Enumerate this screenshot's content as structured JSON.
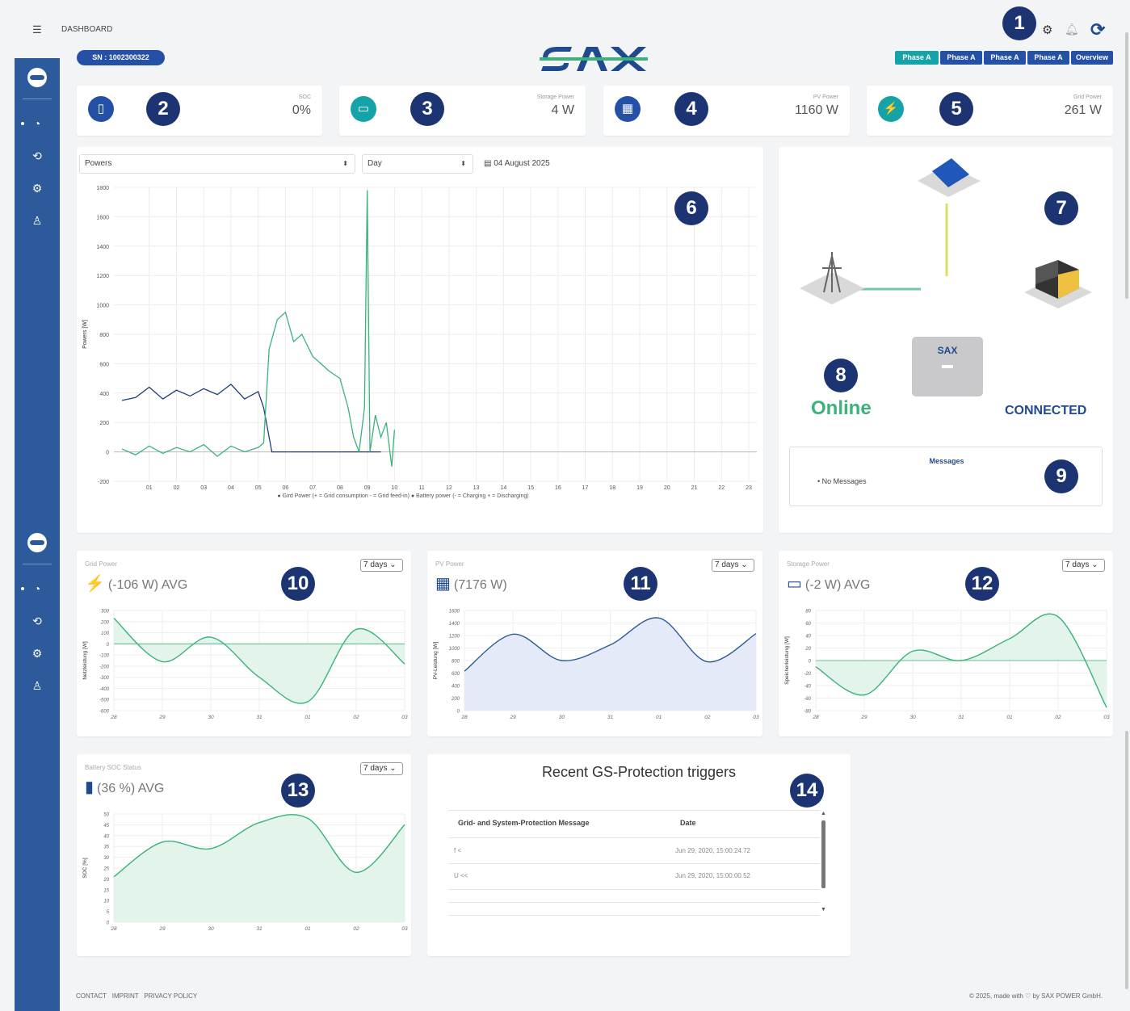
{
  "header": {
    "breadcrumb": "DASHBOARD",
    "serial_badge": "SN : 1002300322",
    "logo_text": "SAX",
    "phase_buttons": [
      "Phase A",
      "Phase A",
      "Phase A",
      "Phase A",
      "Overview"
    ]
  },
  "markers": [
    "1",
    "2",
    "3",
    "4",
    "5",
    "6",
    "7",
    "8",
    "9",
    "10",
    "11",
    "12",
    "13",
    "14"
  ],
  "stats": [
    {
      "label": "SOC",
      "value": "0%",
      "icon": "battery-charge-icon",
      "color": "#2450a6"
    },
    {
      "label": "Storage Power",
      "value": "4 W",
      "icon": "storage-icon",
      "color": "#16a3a8"
    },
    {
      "label": "PV Power",
      "value": "1160 W",
      "icon": "solar-panel-icon",
      "color": "#2450a6"
    },
    {
      "label": "Grid Power",
      "value": "261 W",
      "icon": "grid-tower-icon",
      "color": "#16a3a8"
    }
  ],
  "main_chart": {
    "select_metric": "Powers",
    "select_period": "Day",
    "date": "04 August 2025",
    "chart_data": {
      "type": "line",
      "ylabel": "Powers [W]",
      "ylim": [
        -200,
        1800
      ],
      "yticks": [
        "1800",
        "1600",
        "1400",
        "1200",
        "1000",
        "800",
        "600",
        "400",
        "200",
        "0",
        "-200"
      ],
      "x_ticks": [
        "01",
        "02",
        "03",
        "04",
        "05",
        "06",
        "07",
        "08",
        "09",
        "10",
        "11",
        "12",
        "13",
        "14",
        "15",
        "16",
        "17",
        "18",
        "19",
        "20",
        "21",
        "22",
        "23"
      ],
      "legend": "● Gird Power (+ = Grid consumption - = Grid feed-in)  ● Battery power (- = Charging  + = Discharging)",
      "series": [
        {
          "name": "Battery power",
          "color": "#1f3f7a",
          "x": [
            0,
            0.5,
            1,
            1.5,
            2,
            2.5,
            3,
            3.5,
            4,
            4.5,
            5,
            5.2,
            5.5,
            6,
            7,
            8,
            9,
            9.5
          ],
          "y": [
            350,
            370,
            440,
            360,
            420,
            380,
            430,
            390,
            460,
            360,
            410,
            300,
            0,
            0,
            0,
            0,
            0,
            0
          ]
        },
        {
          "name": "Grid power",
          "color": "#3bb27a",
          "x": [
            0,
            0.5,
            1,
            1.5,
            2,
            2.5,
            3,
            3.5,
            4,
            4.5,
            5,
            5.2,
            5.4,
            5.7,
            6,
            6.3,
            6.6,
            7,
            7.3,
            7.6,
            8,
            8.3,
            8.5,
            8.7,
            8.9,
            9.0,
            9.1,
            9.3,
            9.5,
            9.7,
            9.9,
            10.0
          ],
          "y": [
            20,
            -20,
            40,
            -10,
            30,
            0,
            50,
            -30,
            40,
            0,
            30,
            60,
            700,
            900,
            950,
            750,
            800,
            650,
            600,
            550,
            500,
            300,
            100,
            0,
            300,
            1780,
            0,
            250,
            100,
            200,
            -100,
            150
          ]
        }
      ]
    }
  },
  "system": {
    "status": "Online",
    "connection": "CONNECTED",
    "device_logo": "SAX",
    "messages_title": "Messages",
    "messages": [
      "No Messages"
    ]
  },
  "minis": [
    {
      "title": "Grid Power",
      "avg": "(-106 W) AVG",
      "icon": "grid-tower-icon",
      "select": "7 days",
      "chart_data": {
        "type": "area",
        "ylabel": "Netzleistung [W]",
        "ylim": [
          -600,
          300
        ],
        "yticks": [
          "300",
          "200",
          "100",
          "0",
          "-100",
          "-200",
          "-300",
          "-400",
          "-500",
          "-600"
        ],
        "x": [
          "28",
          "29",
          "30",
          "31",
          "01",
          "02",
          "03"
        ],
        "values": [
          230,
          -160,
          60,
          -300,
          -520,
          130,
          -180
        ],
        "color": "#3bb27a",
        "fill": "#e3f4ea"
      }
    },
    {
      "title": "PV Power",
      "avg": "(7176 W)",
      "icon": "solar-panel-icon",
      "select": "7 days",
      "chart_data": {
        "type": "area",
        "ylabel": "PV-Leistung [W]",
        "ylim": [
          0,
          1600
        ],
        "yticks": [
          "1600",
          "1400",
          "1200",
          "1000",
          "800",
          "600",
          "400",
          "200",
          "0"
        ],
        "x": [
          "28",
          "29",
          "30",
          "31",
          "01",
          "02",
          "03"
        ],
        "values": [
          630,
          1220,
          800,
          1050,
          1480,
          780,
          1230
        ],
        "color": "#2d5a9a",
        "fill": "#e4eaf7"
      }
    },
    {
      "title": "Storage Power",
      "avg": "(-2 W) AVG",
      "icon": "storage-icon",
      "select": "7 days",
      "chart_data": {
        "type": "area",
        "ylabel": "Speicherleistung [W]",
        "ylim": [
          -80,
          80
        ],
        "yticks": [
          "80",
          "60",
          "40",
          "20",
          "0",
          "-20",
          "-40",
          "-60",
          "-80"
        ],
        "x": [
          "28",
          "29",
          "30",
          "31",
          "01",
          "02",
          "03"
        ],
        "values": [
          -10,
          -55,
          15,
          0,
          35,
          70,
          -75
        ],
        "color": "#3bb27a",
        "fill": "#e3f4ea"
      }
    },
    {
      "title": "Battery SOC Status",
      "avg": "(36 %) AVG",
      "icon": "battery-charge-icon",
      "select": "7 days",
      "chart_data": {
        "type": "area",
        "ylabel": "SOC [%]",
        "ylim": [
          0,
          50
        ],
        "yticks": [
          "50",
          "45",
          "40",
          "35",
          "30",
          "25",
          "20",
          "15",
          "10",
          "5",
          "0"
        ],
        "x": [
          "28",
          "29",
          "30",
          "31",
          "01",
          "02",
          "03"
        ],
        "values": [
          21,
          37,
          34,
          46,
          48,
          23,
          45
        ],
        "color": "#3bb27a",
        "fill": "#e3f4ea"
      }
    }
  ],
  "gs_table": {
    "title": "Recent GS-Protection triggers",
    "headers": [
      "Grid- and System-Protection Message",
      "Date"
    ],
    "rows": [
      [
        "f <",
        "Jun 29, 2020, 15:00:24.72"
      ],
      [
        "U <<",
        "Jun 29, 2020, 15:00:00.52"
      ]
    ]
  },
  "footer": {
    "links": [
      "CONTACT",
      "IMPRINT",
      "PRIVACY POLICY"
    ],
    "copyright": "© 2025, made with ♡ by SAX POWER GmbH."
  }
}
